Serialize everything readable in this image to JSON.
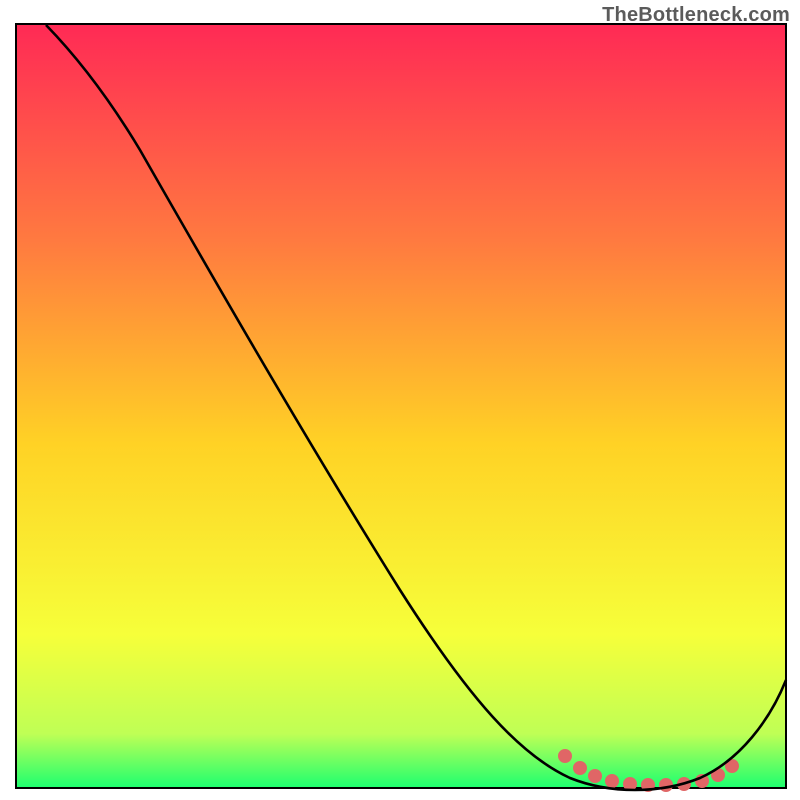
{
  "watermark": {
    "text": "TheBottleneck.com"
  },
  "colors": {
    "grad_top": "#ff2a55",
    "grad_upper_mid": "#ff7940",
    "grad_mid": "#ffd225",
    "grad_lower_mid": "#f6ff3a",
    "grad_near_bottom": "#bfff55",
    "grad_bottom": "#1fff6f",
    "curve": "#000000",
    "highlight": "#e06666",
    "border": "#000000"
  },
  "chart_data": {
    "type": "line",
    "title": "",
    "xlabel": "",
    "ylabel": "",
    "xlim": [
      0,
      100
    ],
    "ylim": [
      0,
      100
    ],
    "series": [
      {
        "name": "bottleneck-curve",
        "x": [
          4,
          8,
          12,
          16,
          20,
          24,
          28,
          32,
          36,
          40,
          44,
          48,
          52,
          56,
          60,
          64,
          68,
          72,
          76,
          80,
          84,
          88,
          92,
          96,
          100
        ],
        "y": [
          100,
          95,
          89,
          83,
          77,
          70,
          63,
          56,
          50,
          44,
          38,
          32,
          26,
          21,
          16,
          11,
          7,
          3,
          1,
          0,
          0,
          1,
          4,
          9,
          16
        ]
      }
    ],
    "annotations": {
      "optimal_range": {
        "x_start": 72,
        "x_end": 92,
        "note": "highlighted minimum band"
      }
    }
  }
}
